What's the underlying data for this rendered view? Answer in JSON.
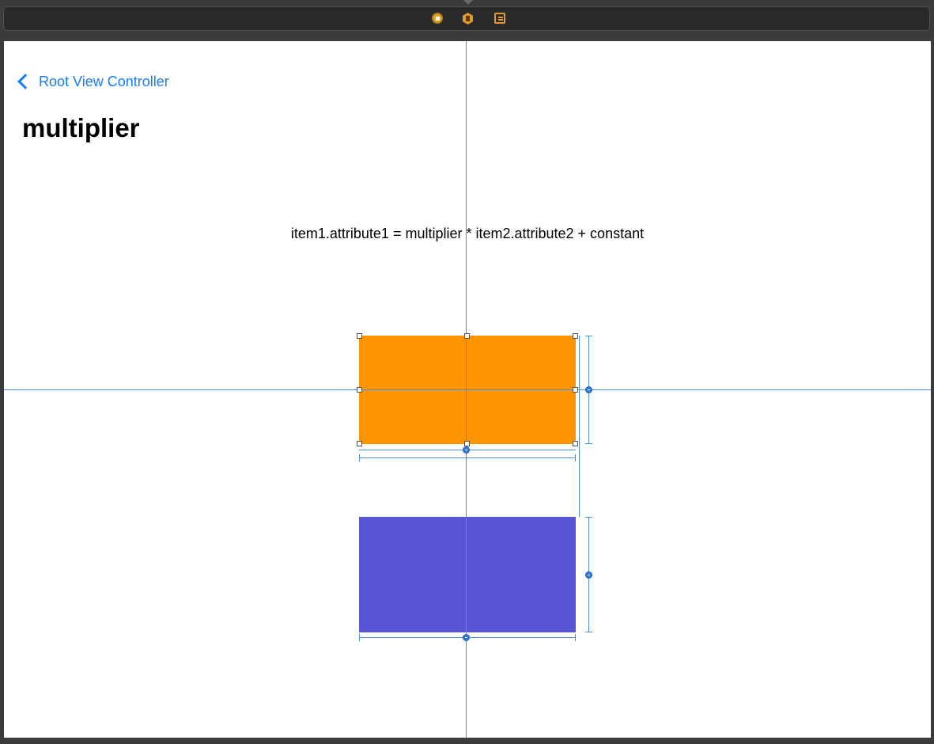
{
  "scene_dock": {
    "icons": [
      "view-controller-icon",
      "first-responder-icon",
      "exit-icon"
    ]
  },
  "navigation": {
    "back_label": "Root View Controller",
    "title": "multiplier"
  },
  "content": {
    "formula": "item1.attribute1 = multiplier * item2.attribute2 + constant"
  },
  "views": {
    "top_view_color": "#ff9500",
    "bottom_view_color": "#5856d6",
    "guide_color": "#4a90d9",
    "accent": "#147efb"
  }
}
